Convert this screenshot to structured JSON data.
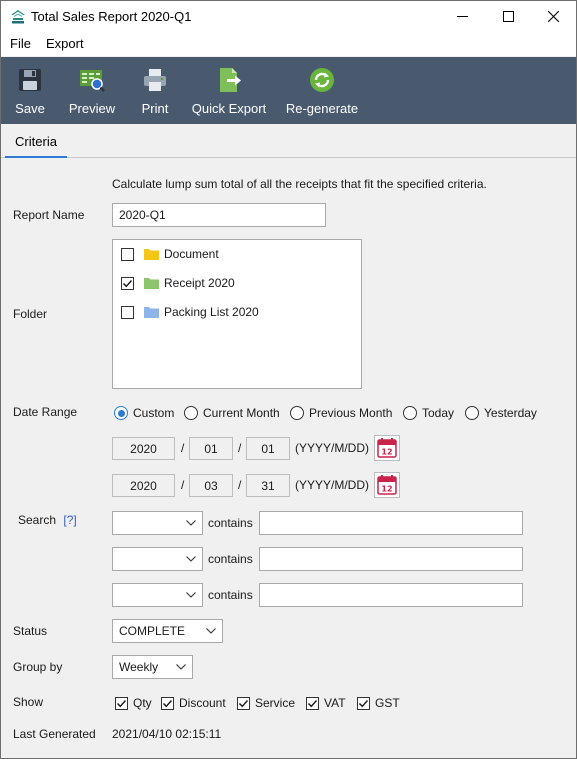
{
  "window": {
    "title": "Total Sales Report 2020-Q1",
    "controls": [
      "minimize",
      "maximize",
      "close"
    ]
  },
  "menu": {
    "file": "File",
    "export": "Export"
  },
  "toolbar": {
    "save": "Save",
    "preview": "Preview",
    "print": "Print",
    "quick_export": "Quick Export",
    "regenerate": "Re-generate"
  },
  "tabs": {
    "criteria": "Criteria"
  },
  "form": {
    "description": "Calculate lump sum total of all the receipts that fit the specified criteria.",
    "report_name_label": "Report Name",
    "report_name_value": "2020-Q1",
    "folder_label": "Folder",
    "folders": [
      {
        "name": "Document",
        "checked": false,
        "color": "#f5c518"
      },
      {
        "name": "Receipt 2020",
        "checked": true,
        "color": "#8cc56e"
      },
      {
        "name": "Packing List 2020",
        "checked": false,
        "color": "#8fb4e8"
      }
    ],
    "date_range_label": "Date Range",
    "date_options": [
      {
        "label": "Custom",
        "selected": true
      },
      {
        "label": "Current Month",
        "selected": false
      },
      {
        "label": "Previous Month",
        "selected": false
      },
      {
        "label": "Today",
        "selected": false
      },
      {
        "label": "Yesterday",
        "selected": false
      }
    ],
    "date_from": {
      "year": "2020",
      "month": "01",
      "day": "01"
    },
    "date_to": {
      "year": "2020",
      "month": "03",
      "day": "31"
    },
    "date_sep": "/",
    "date_format": "(YYYY/M/DD)",
    "calendar_day": "12",
    "search_label": "Search",
    "search_help": "[?]",
    "search_rows": [
      {
        "field": "",
        "op": "contains",
        "value": ""
      },
      {
        "field": "",
        "op": "contains",
        "value": ""
      },
      {
        "field": "",
        "op": "contains",
        "value": ""
      }
    ],
    "status_label": "Status",
    "status_value": "COMPLETE",
    "group_by_label": "Group by",
    "group_by_value": "Weekly",
    "show_label": "Show",
    "show_options": [
      {
        "label": "Qty",
        "checked": true
      },
      {
        "label": "Discount",
        "checked": true
      },
      {
        "label": "Service",
        "checked": true
      },
      {
        "label": "VAT",
        "checked": true
      },
      {
        "label": "GST",
        "checked": true
      }
    ],
    "last_generated_label": "Last Generated",
    "last_generated_value": "2021/04/10 02:15:11"
  },
  "colors": {
    "toolbar_bg": "#4a5a6e",
    "accent": "#2e7bcf",
    "calendar_red": "#c8234a"
  }
}
